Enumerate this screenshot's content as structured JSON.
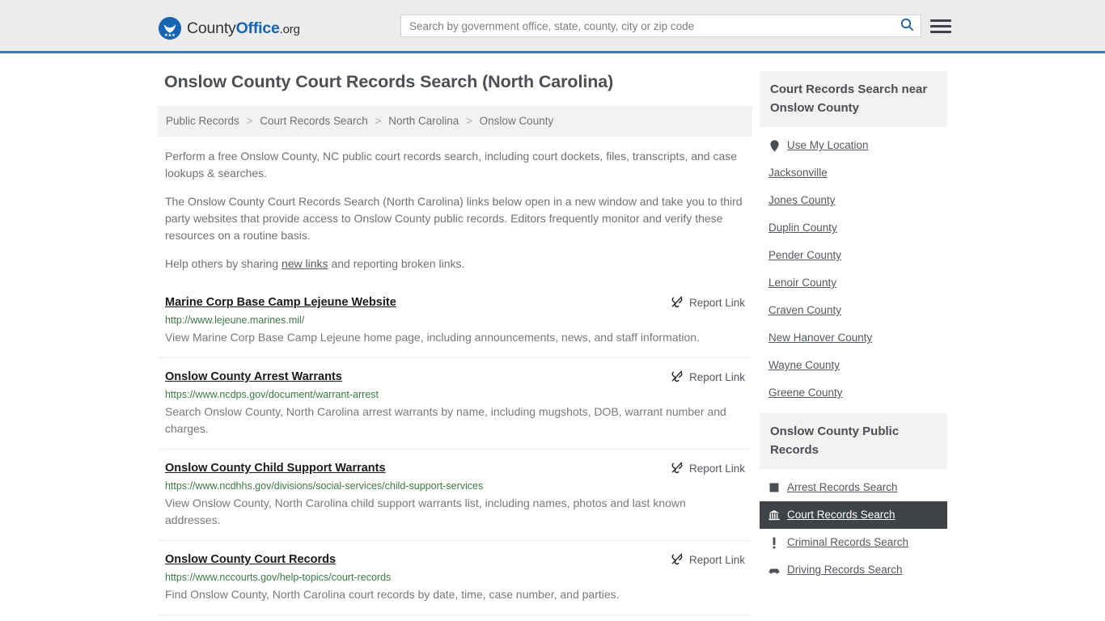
{
  "header": {
    "brand": {
      "part1": "County",
      "part2": "Office",
      "part3": ".org",
      "logo_icon": "eagle-stars-emblem-icon"
    },
    "search": {
      "placeholder": "Search by government office, state, county, city or zip code",
      "value": "",
      "search_icon": "search-icon"
    },
    "menu_icon": "hamburger-menu-icon",
    "accent_color": "#3b77a8"
  },
  "page": {
    "title": "Onslow County Court Records Search (North Carolina)",
    "breadcrumb": [
      "Public Records",
      "Court Records Search",
      "North Carolina",
      "Onslow County"
    ],
    "breadcrumb_separator": ">",
    "intro_paragraphs": [
      "Perform a free Onslow County, NC public court records search, including court dockets, files, transcripts, and case lookups & searches.",
      "The Onslow County Court Records Search (North Carolina) links below open in a new window and take you to third party websites that provide access to Onslow County public records. Editors frequently monitor and verify these resources on a routine basis."
    ],
    "help_text_before": "Help others by sharing ",
    "help_link": "new links",
    "help_text_after": " and reporting broken links."
  },
  "report_link": {
    "label": "Report Link",
    "icon": "broken-link-icon"
  },
  "listings": [
    {
      "title": "Marine Corp Base Camp Lejeune Website",
      "url": "http://www.lejeune.marines.mil/",
      "description": "View Marine Corp Base Camp Lejeune home page, including announcements, news, and staff information."
    },
    {
      "title": "Onslow County Arrest Warrants",
      "url": "https://www.ncdps.gov/document/warrant-arrest",
      "description": "Search Onslow County, North Carolina arrest warrants by name, including mugshots, DOB, warrant number and charges."
    },
    {
      "title": "Onslow County Child Support Warrants",
      "url": "https://www.ncdhhs.gov/divisions/social-services/child-support-services",
      "description": "View Onslow County, North Carolina child support warrants list, including names, photos and last known addresses."
    },
    {
      "title": "Onslow County Court Records",
      "url": "https://www.nccourts.gov/help-topics/court-records",
      "description": "Find Onslow County, North Carolina court records by date, time, case number, and parties."
    }
  ],
  "sidebar": {
    "nearby": {
      "heading": "Court Records Search near Onslow County",
      "use_my_location": {
        "label": "Use My Location",
        "icon": "map-pin-icon"
      },
      "items": [
        "Jacksonville",
        "Jones County",
        "Duplin County",
        "Pender County",
        "Lenoir County",
        "Craven County",
        "New Hanover County",
        "Wayne County",
        "Greene County"
      ]
    },
    "public_records": {
      "heading": "Onslow County Public Records",
      "items": [
        {
          "label": "Arrest Records Search",
          "icon": "filled-square-icon",
          "active": false
        },
        {
          "label": "Court Records Search",
          "icon": "courthouse-icon",
          "active": true
        },
        {
          "label": "Criminal Records Search",
          "icon": "exclamation-mark-icon",
          "active": false
        },
        {
          "label": "Driving Records Search",
          "icon": "car-icon",
          "active": false
        }
      ],
      "active_background": "#3f4246"
    }
  }
}
